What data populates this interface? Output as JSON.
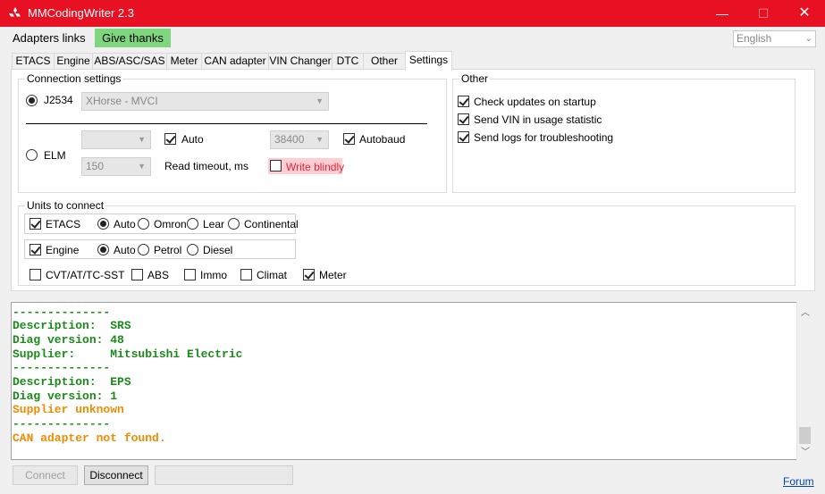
{
  "window": {
    "title": "MMCodingWriter 2.3",
    "minimize": "—",
    "maximize": "☐",
    "close": "✕"
  },
  "menu": {
    "adapters_links": "Adapters links",
    "give_thanks": "Give thanks"
  },
  "language": {
    "selected": "English",
    "arrow": "⌄"
  },
  "tabs": [
    "ETACS",
    "Engine",
    "ABS/ASC/SAS",
    "Meter",
    "CAN adapter",
    "VIN Changer",
    "DTC",
    "Other",
    "Settings"
  ],
  "active_tab": "Settings",
  "connection": {
    "legend": "Connection settings",
    "j2534": {
      "label": "J2534",
      "selected": true,
      "device": "XHorse - MVCI"
    },
    "elm": {
      "label": "ELM",
      "selected": false,
      "port": "",
      "auto_label": "Auto",
      "auto_checked": true,
      "baud": "38400",
      "autobaud_label": "Autobaud",
      "autobaud_checked": true,
      "timeout": "150",
      "timeout_label": "Read timeout, ms",
      "write_blindly_label": "Write blindly",
      "write_blindly_checked": false
    }
  },
  "other": {
    "legend": "Other",
    "items": [
      {
        "label": "Check updates on startup",
        "checked": true
      },
      {
        "label": "Send VIN in usage statistic",
        "checked": true
      },
      {
        "label": "Send logs for troubleshooting",
        "checked": true
      }
    ]
  },
  "units": {
    "legend": "Units to connect",
    "etacs": {
      "label": "ETACS",
      "checked": true,
      "options": [
        "Auto",
        "Omron",
        "Lear",
        "Continental"
      ],
      "selected": "Auto"
    },
    "engine": {
      "label": "Engine",
      "checked": true,
      "options": [
        "Auto",
        "Petrol",
        "Diesel"
      ],
      "selected": "Auto"
    },
    "others": [
      {
        "label": "CVT/AT/TC-SST",
        "checked": false
      },
      {
        "label": "ABS",
        "checked": false
      },
      {
        "label": "Immo",
        "checked": false
      },
      {
        "label": "Climat",
        "checked": false
      },
      {
        "label": "Meter",
        "checked": true
      }
    ]
  },
  "log": {
    "lines": [
      {
        "text": "--------------",
        "color": "#1a8a1a"
      },
      {
        "text": "Description:  SRS",
        "color": "#1a8a1a"
      },
      {
        "text": "Diag version: 48",
        "color": "#1a8a1a"
      },
      {
        "text": "Supplier:     Mitsubishi Electric",
        "color": "#1a8a1a"
      },
      {
        "text": "--------------",
        "color": "#1a8a1a"
      },
      {
        "text": "Description:  EPS",
        "color": "#1a8a1a"
      },
      {
        "text": "Diag version: 1",
        "color": "#1a8a1a"
      },
      {
        "text": "Supplier unknown",
        "color": "#f08c00"
      },
      {
        "text": "--------------",
        "color": "#1a8a1a"
      },
      {
        "text": "CAN adapter not found.",
        "color": "#f08c00"
      }
    ]
  },
  "footer": {
    "connect": "Connect",
    "disconnect": "Disconnect",
    "status": "",
    "forum": "Forum"
  },
  "colors": {
    "titlebar": "#e81123",
    "give_thanks": "#7ed67e",
    "write_blindly_bg": "#ffcdd2",
    "write_blindly_text": "#e0283c",
    "log_green": "#1a8a1a",
    "log_orange": "#f08c00"
  }
}
